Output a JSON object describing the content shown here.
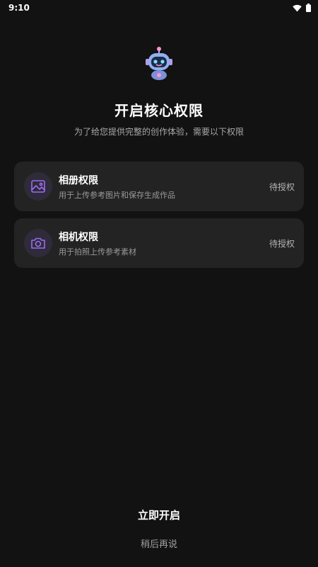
{
  "status_bar": {
    "time": "9:10",
    "icons": [
      "wifi-icon",
      "battery-icon"
    ]
  },
  "header": {
    "mascot_icon": "robot-mascot-icon",
    "title": "开启核心权限",
    "subtitle": "为了给您提供完整的创作体验，需要以下权限"
  },
  "permissions": [
    {
      "icon": "gallery-icon",
      "title": "相册权限",
      "description": "用于上传参考图片和保存生成作品",
      "status": "待授权"
    },
    {
      "icon": "camera-icon",
      "title": "相机权限",
      "description": "用于拍照上传参考素材",
      "status": "待授权"
    }
  ],
  "actions": {
    "enable_label": "立即开启",
    "later_label": "稍后再说"
  },
  "colors": {
    "background": "#121212",
    "card": "#232323",
    "accent": "#9b6cf0"
  }
}
